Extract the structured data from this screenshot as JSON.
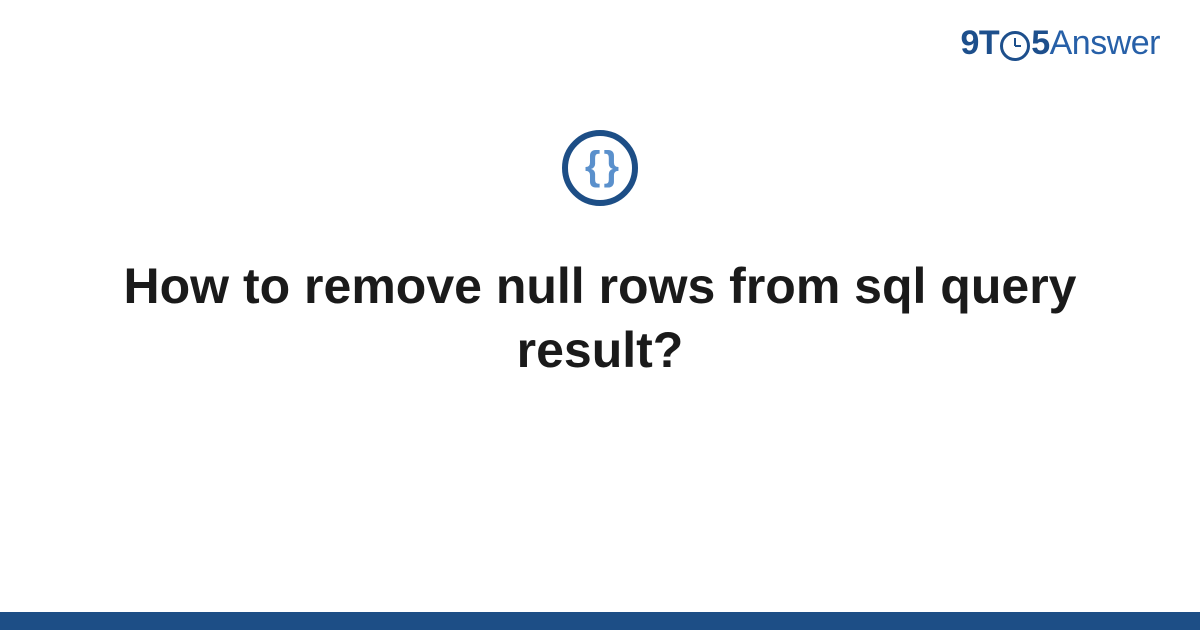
{
  "logo": {
    "part_nine": "9",
    "part_t": "T",
    "part_five": "5",
    "part_answer": "Answer"
  },
  "icon": {
    "braces": "{ }"
  },
  "question": {
    "title": "How to remove null rows from sql query result?"
  },
  "colors": {
    "brand_dark": "#1d4e86",
    "brand_light": "#5a90cc"
  }
}
